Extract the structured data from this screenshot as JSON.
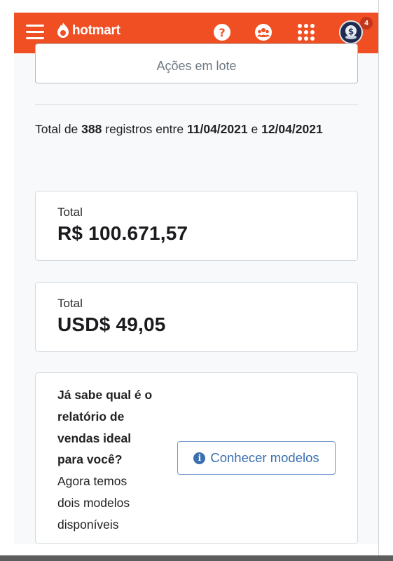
{
  "header": {
    "logo_text": "hotmart",
    "notification_count": "4",
    "icons": [
      "menu-icon",
      "flame-icon",
      "help-icon",
      "community-icon",
      "apps-grid-icon",
      "coin-avatar-icon"
    ],
    "brand_color": "#f04e23"
  },
  "bulk_actions": {
    "label": "Ações em lote"
  },
  "summary": {
    "prefix": "Total de",
    "count": "388",
    "middle": "registros entre",
    "date_start": "11/04/2021",
    "conjunction": "e",
    "date_end": "12/04/2021"
  },
  "totals": [
    {
      "label": "Total",
      "amount": "R$ 100.671,57"
    },
    {
      "label": "Total",
      "amount": "USD$ 49,05"
    }
  ],
  "promo": {
    "question_lines": [
      "Já sabe qual é o",
      "relatório de",
      "vendas ideal",
      "para você?"
    ],
    "body_lines": [
      "Agora temos",
      "dois modelos",
      "disponíveis"
    ],
    "button_label": "Conhecer modelos",
    "accent_color": "#3a6fb0"
  }
}
